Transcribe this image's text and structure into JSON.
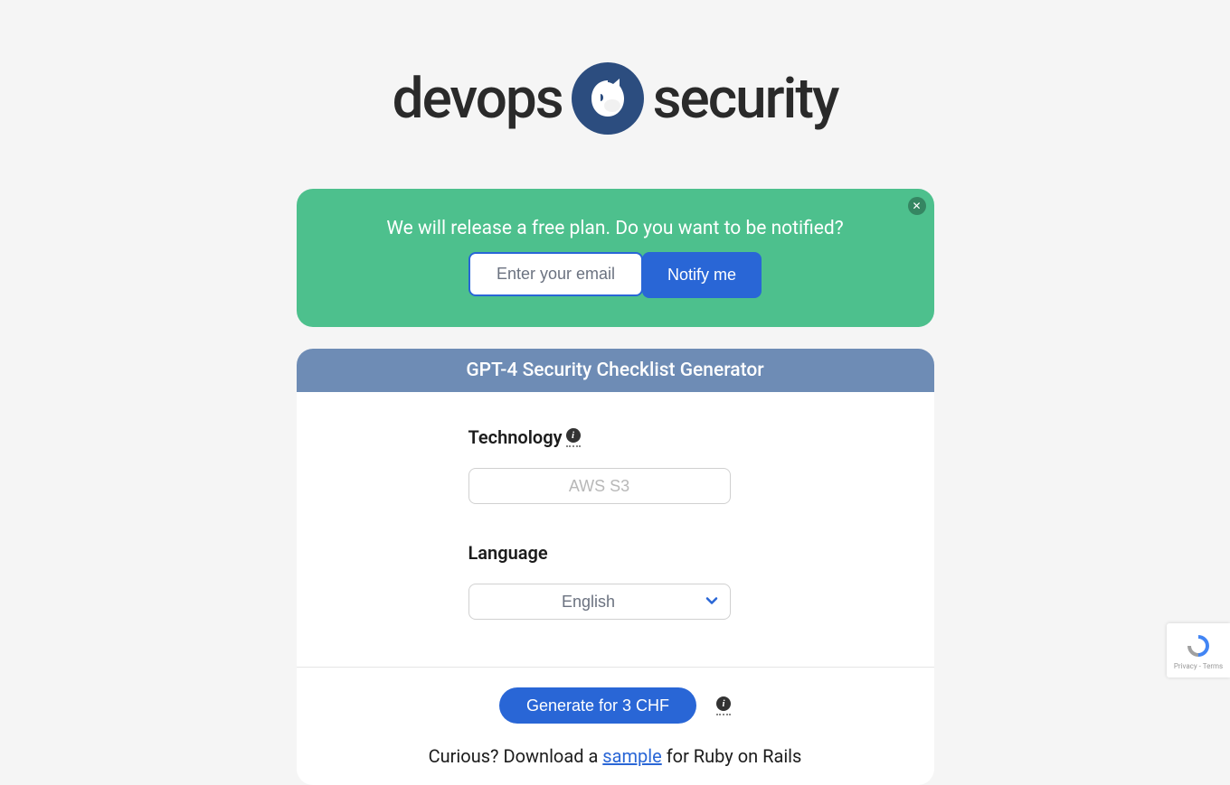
{
  "logo": {
    "text_left": "devops",
    "text_right": "security"
  },
  "banner": {
    "message": "We will release a free plan. Do you want to be notified?",
    "email_placeholder": "Enter your email",
    "notify_button": "Notify me"
  },
  "card": {
    "title": "GPT-4 Security Checklist Generator",
    "technology_label": "Technology",
    "technology_placeholder": "AWS S3",
    "language_label": "Language",
    "language_value": "English",
    "generate_button": "Generate for 3 CHF",
    "curious_prefix": "Curious? Download a ",
    "sample_link": "sample",
    "curious_suffix": " for Ruby on Rails"
  },
  "recaptcha": {
    "privacy": "Privacy",
    "terms": "Terms"
  }
}
